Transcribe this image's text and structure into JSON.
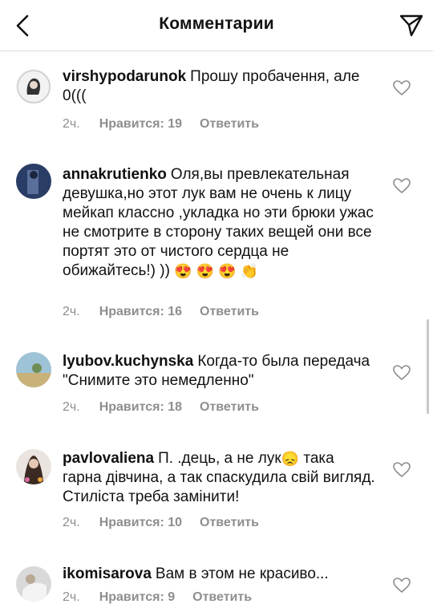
{
  "header": {
    "title": "Комментарии"
  },
  "comments": [
    {
      "username": "virshypodarunok",
      "text": "Прошу пробачення, але 0(((",
      "time": "2ч.",
      "likes": "Нравится: 19",
      "reply": "Ответить"
    },
    {
      "username": "annakrutienko",
      "text": "Оля,вы превлекательная девушка,но этот лук вам не очень к лицу мейкап классно ,укладка но эти брюки ужас не смотрите в сторону таких вещей они все портят это от чистого сердца не обижайтесь!) ))",
      "emoji": "😍 😍 😍 👏",
      "time": "2ч.",
      "likes": "Нравится: 16",
      "reply": "Ответить"
    },
    {
      "username": "lyubov.kuchynska",
      "text": "Когда-то была передача \"Снимите это немедленно\"",
      "time": "2ч.",
      "likes": "Нравится: 18",
      "reply": "Ответить"
    },
    {
      "username": "pavlovaliena",
      "text_part1": "П. .дець, а не лук",
      "emoji": "😞",
      "text_part2": "така гарна дівчина, а так спаскудила свій вигляд. Стиліста треба замінити!",
      "time": "2ч.",
      "likes": "Нравится: 10",
      "reply": "Ответить"
    },
    {
      "username": "ikomisarova",
      "text": "Вам в этом не красиво...",
      "time": "2ч.",
      "likes": "Нравится: 9",
      "reply": "Ответить"
    }
  ]
}
